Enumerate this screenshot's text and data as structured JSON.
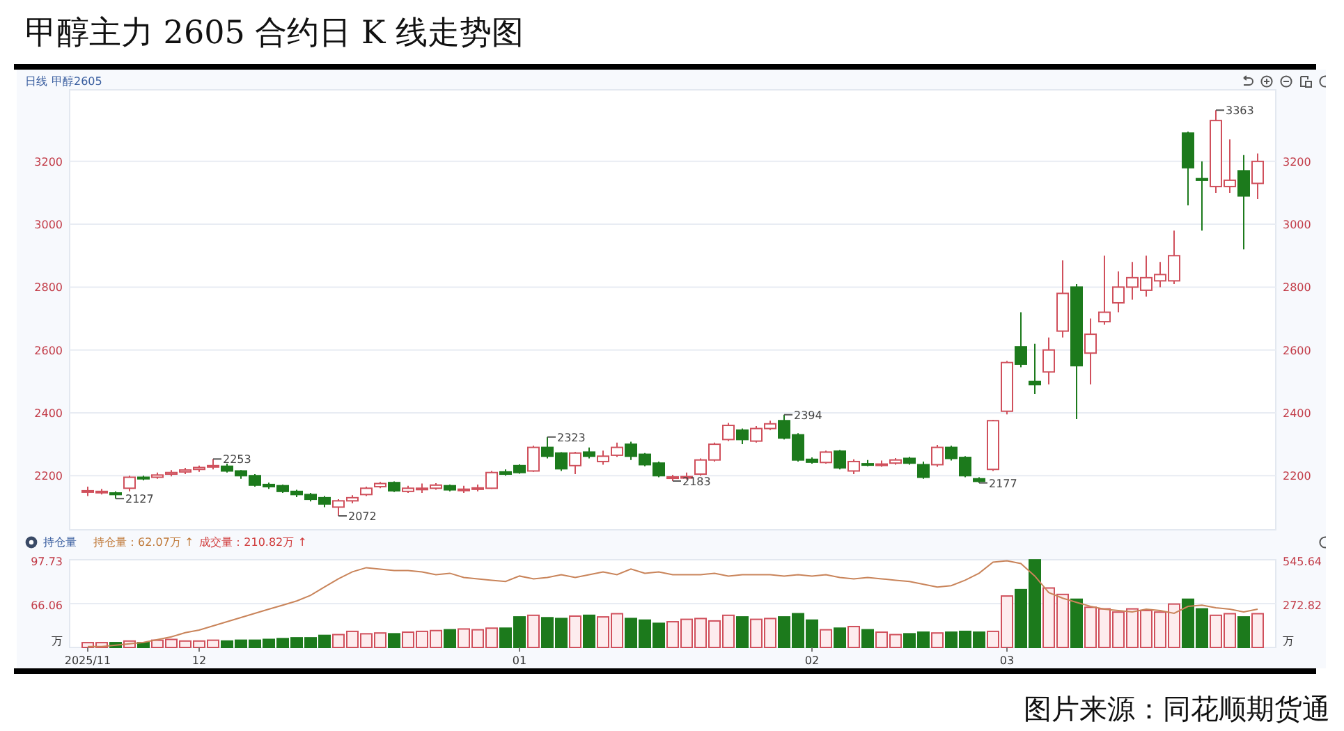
{
  "title": "甲醇主力 2605 合约日 K 线走势图",
  "header": {
    "period": "日线",
    "symbol": "甲醇2605"
  },
  "price_chart": {
    "right_axis_labels": [
      "3200",
      "3000",
      "2800",
      "2600",
      "2400",
      "2200"
    ],
    "chart_data": {
      "type": "candlestick",
      "ylim": [
        2030,
        3430
      ],
      "grid": true,
      "yticks": [
        2200,
        2400,
        2600,
        2800,
        3000,
        3200
      ],
      "ohlc": [
        [
          2150,
          2165,
          2135,
          2152
        ],
        [
          2148,
          2158,
          2140,
          2150
        ],
        [
          2145,
          2150,
          2127,
          2140
        ],
        [
          2160,
          2200,
          2150,
          2195
        ],
        [
          2195,
          2200,
          2185,
          2190
        ],
        [
          2195,
          2210,
          2190,
          2202
        ],
        [
          2205,
          2218,
          2198,
          2210
        ],
        [
          2212,
          2225,
          2205,
          2218
        ],
        [
          2220,
          2232,
          2212,
          2226
        ],
        [
          2228,
          2253,
          2220,
          2232
        ],
        [
          2230,
          2238,
          2210,
          2215
        ],
        [
          2215,
          2218,
          2190,
          2200
        ],
        [
          2200,
          2205,
          2165,
          2170
        ],
        [
          2172,
          2178,
          2158,
          2165
        ],
        [
          2168,
          2172,
          2145,
          2150
        ],
        [
          2150,
          2155,
          2132,
          2140
        ],
        [
          2140,
          2145,
          2118,
          2125
        ],
        [
          2130,
          2135,
          2100,
          2110
        ],
        [
          2100,
          2125,
          2072,
          2120
        ],
        [
          2120,
          2138,
          2112,
          2130
        ],
        [
          2140,
          2165,
          2135,
          2160
        ],
        [
          2165,
          2180,
          2160,
          2175
        ],
        [
          2178,
          2182,
          2148,
          2152
        ],
        [
          2150,
          2168,
          2145,
          2160
        ],
        [
          2158,
          2175,
          2145,
          2160
        ],
        [
          2160,
          2176,
          2155,
          2170
        ],
        [
          2168,
          2172,
          2150,
          2155
        ],
        [
          2156,
          2168,
          2145,
          2157
        ],
        [
          2160,
          2172,
          2150,
          2161
        ],
        [
          2160,
          2215,
          2158,
          2210
        ],
        [
          2212,
          2220,
          2200,
          2205
        ],
        [
          2232,
          2236,
          2206,
          2210
        ],
        [
          2215,
          2295,
          2212,
          2290
        ],
        [
          2290,
          2323,
          2255,
          2262
        ],
        [
          2272,
          2275,
          2215,
          2222
        ],
        [
          2232,
          2276,
          2205,
          2272
        ],
        [
          2275,
          2290,
          2255,
          2262
        ],
        [
          2245,
          2280,
          2235,
          2262
        ],
        [
          2265,
          2305,
          2260,
          2290
        ],
        [
          2300,
          2308,
          2250,
          2262
        ],
        [
          2268,
          2272,
          2230,
          2235
        ],
        [
          2240,
          2245,
          2195,
          2200
        ],
        [
          2195,
          2203,
          2183,
          2196
        ],
        [
          2196,
          2210,
          2188,
          2197
        ],
        [
          2205,
          2255,
          2200,
          2250
        ],
        [
          2250,
          2305,
          2245,
          2300
        ],
        [
          2315,
          2368,
          2310,
          2360
        ],
        [
          2345,
          2350,
          2300,
          2315
        ],
        [
          2310,
          2358,
          2305,
          2350
        ],
        [
          2350,
          2375,
          2345,
          2365
        ],
        [
          2375,
          2394,
          2315,
          2320
        ],
        [
          2330,
          2335,
          2245,
          2250
        ],
        [
          2252,
          2258,
          2238,
          2243
        ],
        [
          2242,
          2280,
          2238,
          2275
        ],
        [
          2278,
          2282,
          2220,
          2225
        ],
        [
          2215,
          2252,
          2205,
          2245
        ],
        [
          2238,
          2250,
          2230,
          2235
        ],
        [
          2236,
          2248,
          2228,
          2237
        ],
        [
          2240,
          2256,
          2235,
          2250
        ],
        [
          2255,
          2260,
          2235,
          2240
        ],
        [
          2235,
          2245,
          2190,
          2195
        ],
        [
          2235,
          2298,
          2228,
          2290
        ],
        [
          2290,
          2295,
          2248,
          2255
        ],
        [
          2258,
          2262,
          2195,
          2200
        ],
        [
          2190,
          2195,
          2177,
          2182
        ],
        [
          2220,
          2378,
          2215,
          2375
        ],
        [
          2405,
          2565,
          2395,
          2560
        ],
        [
          2610,
          2720,
          2545,
          2555
        ],
        [
          2500,
          2620,
          2460,
          2490
        ],
        [
          2530,
          2640,
          2490,
          2600
        ],
        [
          2660,
          2885,
          2640,
          2780
        ],
        [
          2800,
          2810,
          2380,
          2550
        ],
        [
          2590,
          2700,
          2490,
          2650
        ],
        [
          2690,
          2900,
          2680,
          2720
        ],
        [
          2750,
          2850,
          2720,
          2800
        ],
        [
          2800,
          2880,
          2760,
          2830
        ],
        [
          2790,
          2900,
          2770,
          2830
        ],
        [
          2820,
          2880,
          2800,
          2840
        ],
        [
          2820,
          2980,
          2810,
          2900
        ],
        [
          3290,
          3295,
          3060,
          3180
        ],
        [
          3145,
          3200,
          2980,
          3140
        ],
        [
          3120,
          3363,
          3100,
          3330
        ],
        [
          3120,
          3270,
          3100,
          3140
        ],
        [
          3170,
          3220,
          2920,
          3090
        ],
        [
          3130,
          3225,
          3080,
          3200
        ]
      ],
      "annotations": [
        "2127",
        "2253",
        "2072",
        "2323",
        "2183",
        "2394",
        "2177",
        "3363"
      ]
    }
  },
  "legend": {
    "toggle_label": "持仓量",
    "items": [
      {
        "label": "持仓量：",
        "value": "62.07万",
        "arrow": "↑",
        "color": "#c07a3a"
      },
      {
        "label": "成交量：",
        "value": "210.82万",
        "arrow": "↑",
        "color": "#d03a3a"
      }
    ]
  },
  "volume_chart": {
    "chart_data": {
      "type": "bar",
      "ylim": [
        0,
        545.64
      ],
      "ylabel": "万",
      "grid": true,
      "categories": [
        "2025/11",
        null,
        null,
        null,
        null,
        null,
        null,
        null,
        "12",
        null,
        null,
        null,
        null,
        null,
        null,
        null,
        null,
        null,
        null,
        null,
        null,
        null,
        null,
        null,
        null,
        null,
        null,
        null,
        null,
        null,
        null,
        "01",
        null,
        null,
        null,
        null,
        null,
        null,
        null,
        null,
        null,
        null,
        null,
        null,
        null,
        null,
        null,
        null,
        null,
        null,
        null,
        null,
        "02",
        null,
        null,
        null,
        null,
        null,
        null,
        null,
        null,
        null,
        null,
        null,
        null,
        null,
        "03",
        null,
        null,
        null,
        null,
        null,
        null,
        null,
        null,
        null,
        null,
        null,
        null,
        null,
        null,
        null,
        null,
        null,
        null
      ],
      "yticks": [
        {
          "value": 545.64,
          "label": "545.64"
        },
        {
          "value": 272.82,
          "label": "272.82"
        }
      ],
      "series": [
        {
          "values": [
            30,
            30,
            30,
            40,
            30,
            45,
            50,
            40,
            40,
            45,
            40,
            45,
            45,
            50,
            55,
            60,
            60,
            75,
            80,
            100,
            85,
            90,
            85,
            95,
            100,
            105,
            110,
            115,
            110,
            120,
            120,
            190,
            200,
            185,
            180,
            195,
            200,
            190,
            210,
            180,
            170,
            150,
            160,
            175,
            180,
            165,
            200,
            190,
            175,
            180,
            190,
            210,
            170,
            110,
            120,
            130,
            110,
            95,
            80,
            85,
            95,
            90,
            95,
            100,
            95,
            100,
            320,
            360,
            545,
            370,
            330,
            300,
            250,
            240,
            220,
            240,
            230,
            220,
            270,
            300,
            240,
            200,
            210,
            190,
            210
          ]
        }
      ]
    }
  },
  "open_interest_chart": {
    "chart_data": {
      "type": "line",
      "ylim": [
        34.39,
        97.73
      ],
      "ylabel": "万",
      "yticks": [
        {
          "value": 97.73,
          "label": "97.73"
        },
        {
          "value": 66.06,
          "label": "66.06"
        }
      ],
      "series": [
        {
          "color": "#c9845a",
          "values": [
            35,
            35,
            36,
            37,
            38,
            40,
            42,
            45,
            47,
            50,
            53,
            56,
            59,
            62,
            65,
            68,
            72,
            78,
            84,
            89,
            92,
            91,
            90,
            90,
            89,
            87,
            88,
            85,
            84,
            83,
            82,
            86,
            84,
            85,
            87,
            85,
            87,
            89,
            87,
            91,
            88,
            89,
            87,
            87,
            87,
            88,
            86,
            87,
            87,
            87,
            86,
            87,
            86,
            87,
            85,
            84,
            85,
            84,
            83,
            82,
            80,
            78,
            79,
            83,
            88,
            96,
            97,
            95,
            86,
            74,
            70,
            67,
            64,
            62,
            61,
            60,
            62,
            61,
            59,
            64,
            65,
            63,
            62,
            60,
            62
          ]
        }
      ]
    }
  },
  "source": "图片来源：同花顺期货通"
}
